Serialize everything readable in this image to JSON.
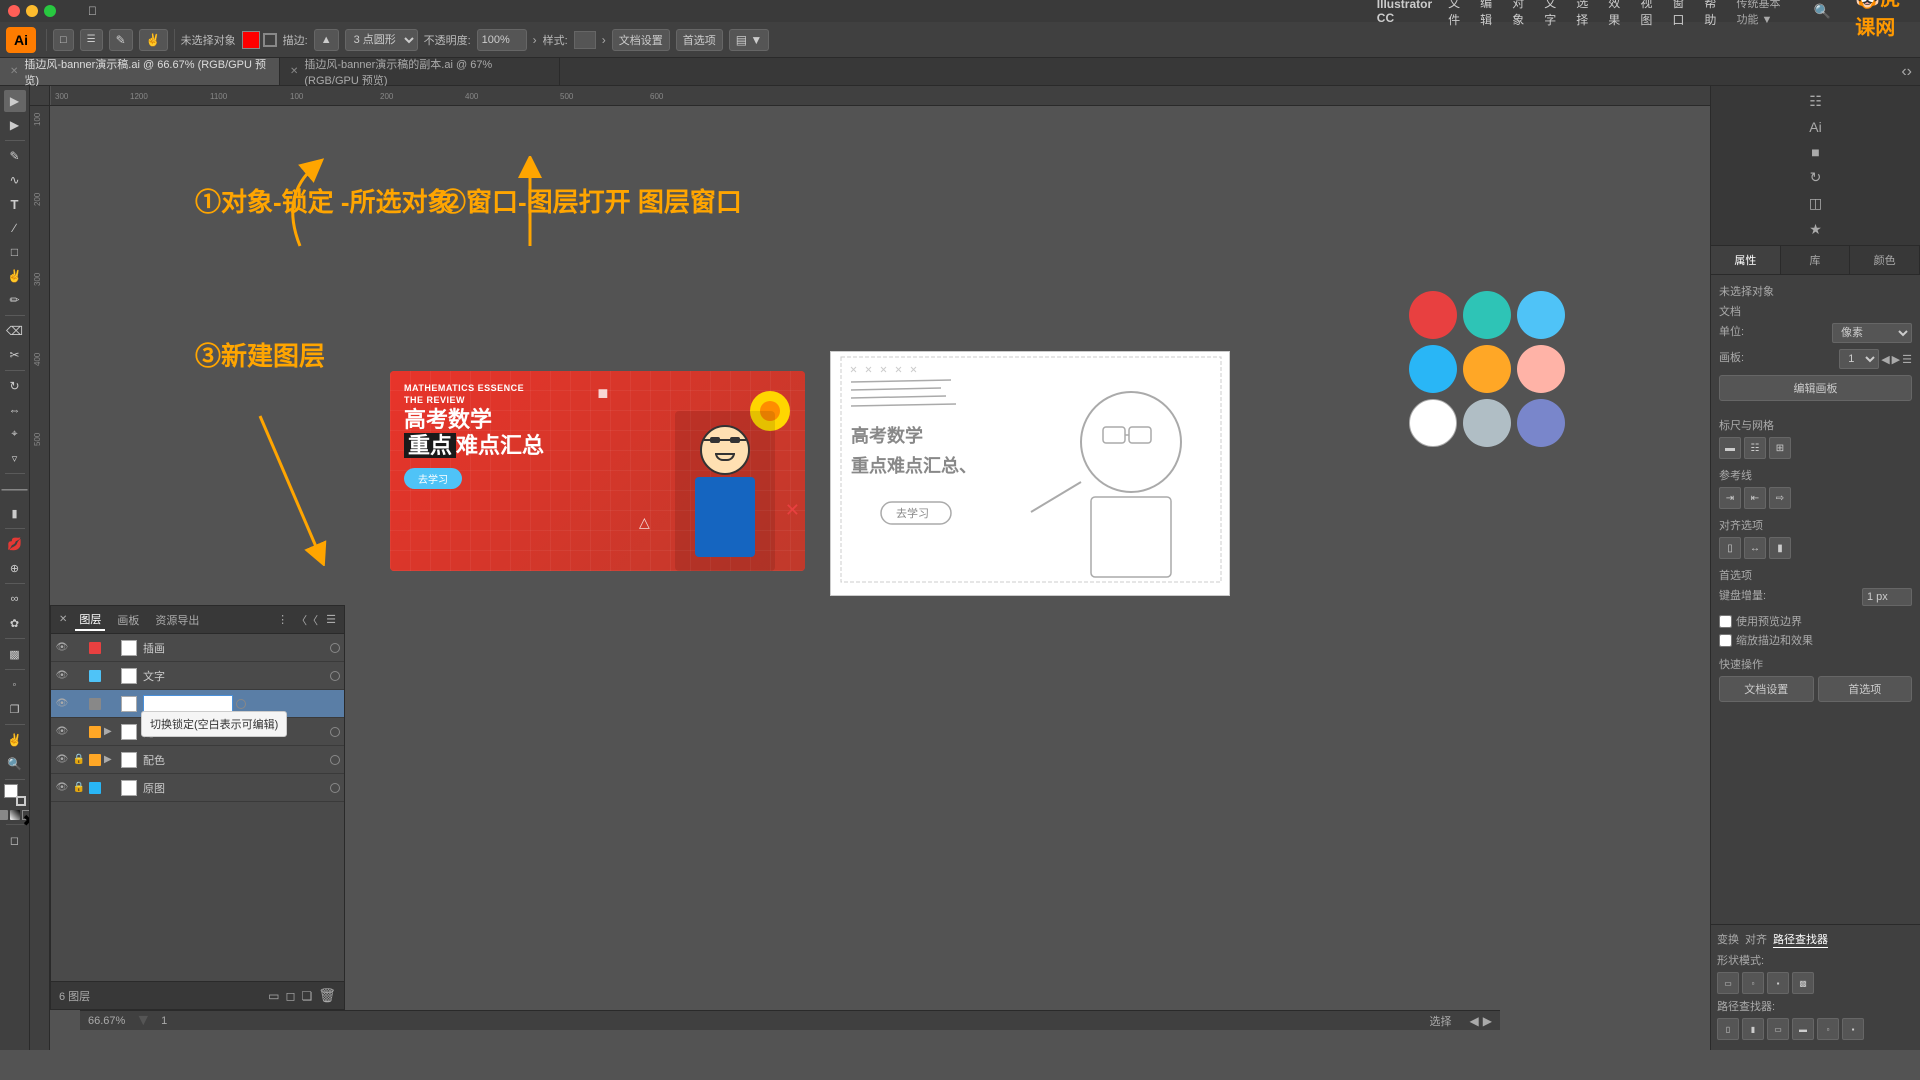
{
  "app": {
    "name": "Illustrator CC",
    "logo": "Ai",
    "zoom": "66.67%"
  },
  "menubar": {
    "apple": "&#63743;",
    "items": [
      "Illustrator CC",
      "文件",
      "编辑",
      "对象",
      "文字",
      "选择",
      "效果",
      "视图",
      "窗口",
      "帮助"
    ]
  },
  "toolbar": {
    "no_selection": "未选择对象",
    "stroke_label": "描边:",
    "opacity_label": "不透明度:",
    "opacity_value": "100%",
    "style_label": "样式:",
    "doc_settings": "文档设置",
    "preferences": "首选项",
    "three_pt": "3 点圆形"
  },
  "tabs": [
    {
      "name": "插边风-banner演示稿.ai",
      "detail": "@ 66.67% (RGB/GPU 预览)",
      "active": true
    },
    {
      "name": "插边风-banner演示稿的副本.ai",
      "detail": "@ 67% (RGB/GPU 预览)",
      "active": false
    }
  ],
  "annotations": {
    "arrow1_label": "①对象-锁定\n-所选对象",
    "arrow2_label": "②窗口-图层打开\n图层窗口",
    "arrow3_label": "③新建图层"
  },
  "right_panel": {
    "tabs": [
      "属性",
      "库",
      "颜色"
    ],
    "active_tab": "属性",
    "no_selection": "未选择对象",
    "doc_section": "文档",
    "unit_label": "单位:",
    "unit_value": "像素",
    "artboard_label": "画板:",
    "artboard_value": "1",
    "edit_template": "编辑画板",
    "rulers_label": "标尺与网格",
    "guides_label": "参考线",
    "align_label": "对齐选项",
    "snap_label": "首选项",
    "keyboard_increment_label": "键盘增量:",
    "keyboard_increment_value": "1 px",
    "use_preview_bounds": "使用预览边界",
    "snap_corners": "缩放描边和效果",
    "quick_actions_label": "快速操作",
    "doc_settings_btn": "文档设置",
    "preferences_btn": "首选项"
  },
  "swatches": [
    {
      "color": "#e84040",
      "label": "red"
    },
    {
      "color": "#2ec4b6",
      "label": "teal"
    },
    {
      "color": "#4fc3f7",
      "label": "light-blue"
    },
    {
      "color": "#29b6f6",
      "label": "blue"
    },
    {
      "color": "#ffa726",
      "label": "orange"
    },
    {
      "color": "#ffb3a7",
      "label": "pink"
    },
    {
      "color": "#ffffff",
      "label": "white"
    },
    {
      "color": "#b0bec5",
      "label": "light-gray"
    },
    {
      "color": "#7986cb",
      "label": "purple-gray"
    }
  ],
  "layers_panel": {
    "tabs": [
      "图层",
      "画板",
      "资源导出"
    ],
    "active_tab": "图层",
    "layers": [
      {
        "name": "插画",
        "visible": true,
        "locked": false,
        "color": "#e84040",
        "has_children": false
      },
      {
        "name": "文字",
        "visible": true,
        "locked": false,
        "color": "#4fc3f7",
        "has_children": false
      },
      {
        "name": "",
        "visible": true,
        "locked": false,
        "color": "#888",
        "has_children": false,
        "editing": true
      },
      {
        "name": "配色",
        "visible": true,
        "locked": false,
        "color": "#ffa726",
        "has_children": true,
        "expanded": false
      },
      {
        "name": "配色",
        "visible": true,
        "locked": true,
        "color": "#ffa726",
        "has_children": true,
        "expanded": false
      },
      {
        "name": "原图",
        "visible": true,
        "locked": true,
        "color": "#29b6f6",
        "has_children": false
      }
    ],
    "footer_count": "6 图层",
    "tooltip_text": "切换锁定(空白表示可编辑)"
  },
  "status_bar": {
    "zoom": "66.67%",
    "tool": "选择"
  },
  "bottom_panel": {
    "path_finder": "路径查找器",
    "shape_mode": "形状模式:",
    "path_finder_ops": "路径查找器:"
  }
}
